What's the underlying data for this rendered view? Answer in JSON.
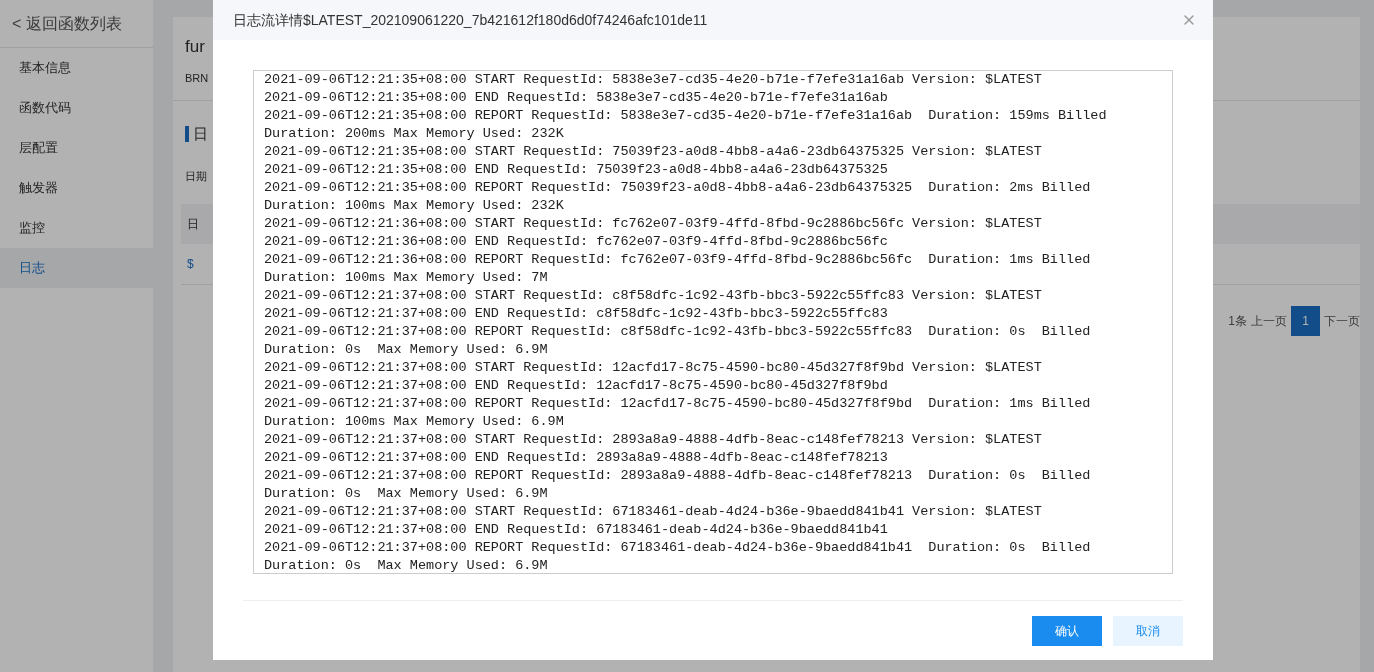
{
  "sidebar": {
    "back_link": "< 返回函数列表",
    "items": [
      {
        "label": "基本信息",
        "selected": false
      },
      {
        "label": "函数代码",
        "selected": false
      },
      {
        "label": "层配置",
        "selected": false
      },
      {
        "label": "触发器",
        "selected": false
      },
      {
        "label": "监控",
        "selected": false
      },
      {
        "label": "日志",
        "selected": true
      }
    ]
  },
  "page": {
    "title": "fur",
    "subtitle": "BRN",
    "section_title": "日",
    "filter_label": "日期",
    "table": {
      "columns": [
        "日"
      ],
      "rows": [
        [
          "$"
        ]
      ]
    },
    "pagination": {
      "total": "1条",
      "prev": "上一页",
      "pages": [
        {
          "label": "1",
          "selected": true
        }
      ],
      "next": "下一页"
    }
  },
  "dialog": {
    "title": "日志流详情$LATEST_202109061220_7b421612f180d6d0f74246afc101de11",
    "log_lines": [
      "2021-09-06T12:21:35+08:00 START RequestId: 5838e3e7-cd35-4e20-b71e-f7efe31a16ab Version: $LATEST",
      "2021-09-06T12:21:35+08:00 END RequestId: 5838e3e7-cd35-4e20-b71e-f7efe31a16ab",
      "2021-09-06T12:21:35+08:00 REPORT RequestId: 5838e3e7-cd35-4e20-b71e-f7efe31a16ab  Duration: 159ms Billed",
      "Duration: 200ms Max Memory Used: 232K",
      "2021-09-06T12:21:35+08:00 START RequestId: 75039f23-a0d8-4bb8-a4a6-23db64375325 Version: $LATEST",
      "2021-09-06T12:21:35+08:00 END RequestId: 75039f23-a0d8-4bb8-a4a6-23db64375325",
      "2021-09-06T12:21:35+08:00 REPORT RequestId: 75039f23-a0d8-4bb8-a4a6-23db64375325  Duration: 2ms Billed",
      "Duration: 100ms Max Memory Used: 232K",
      "2021-09-06T12:21:36+08:00 START RequestId: fc762e07-03f9-4ffd-8fbd-9c2886bc56fc Version: $LATEST",
      "2021-09-06T12:21:36+08:00 END RequestId: fc762e07-03f9-4ffd-8fbd-9c2886bc56fc",
      "2021-09-06T12:21:36+08:00 REPORT RequestId: fc762e07-03f9-4ffd-8fbd-9c2886bc56fc  Duration: 1ms Billed",
      "Duration: 100ms Max Memory Used: 7M",
      "2021-09-06T12:21:37+08:00 START RequestId: c8f58dfc-1c92-43fb-bbc3-5922c55ffc83 Version: $LATEST",
      "2021-09-06T12:21:37+08:00 END RequestId: c8f58dfc-1c92-43fb-bbc3-5922c55ffc83",
      "2021-09-06T12:21:37+08:00 REPORT RequestId: c8f58dfc-1c92-43fb-bbc3-5922c55ffc83  Duration: 0s  Billed",
      "Duration: 0s  Max Memory Used: 6.9M",
      "2021-09-06T12:21:37+08:00 START RequestId: 12acfd17-8c75-4590-bc80-45d327f8f9bd Version: $LATEST",
      "2021-09-06T12:21:37+08:00 END RequestId: 12acfd17-8c75-4590-bc80-45d327f8f9bd",
      "2021-09-06T12:21:37+08:00 REPORT RequestId: 12acfd17-8c75-4590-bc80-45d327f8f9bd  Duration: 1ms Billed",
      "Duration: 100ms Max Memory Used: 6.9M",
      "2021-09-06T12:21:37+08:00 START RequestId: 2893a8a9-4888-4dfb-8eac-c148fef78213 Version: $LATEST",
      "2021-09-06T12:21:37+08:00 END RequestId: 2893a8a9-4888-4dfb-8eac-c148fef78213",
      "2021-09-06T12:21:37+08:00 REPORT RequestId: 2893a8a9-4888-4dfb-8eac-c148fef78213  Duration: 0s  Billed",
      "Duration: 0s  Max Memory Used: 6.9M",
      "2021-09-06T12:21:37+08:00 START RequestId: 67183461-deab-4d24-b36e-9baedd841b41 Version: $LATEST",
      "2021-09-06T12:21:37+08:00 END RequestId: 67183461-deab-4d24-b36e-9baedd841b41",
      "2021-09-06T12:21:37+08:00 REPORT RequestId: 67183461-deab-4d24-b36e-9baedd841b41  Duration: 0s  Billed",
      "Duration: 0s  Max Memory Used: 6.9M"
    ],
    "buttons": [
      {
        "label": "确认",
        "kind": "primary"
      },
      {
        "label": "取消",
        "kind": "secondary"
      }
    ]
  }
}
